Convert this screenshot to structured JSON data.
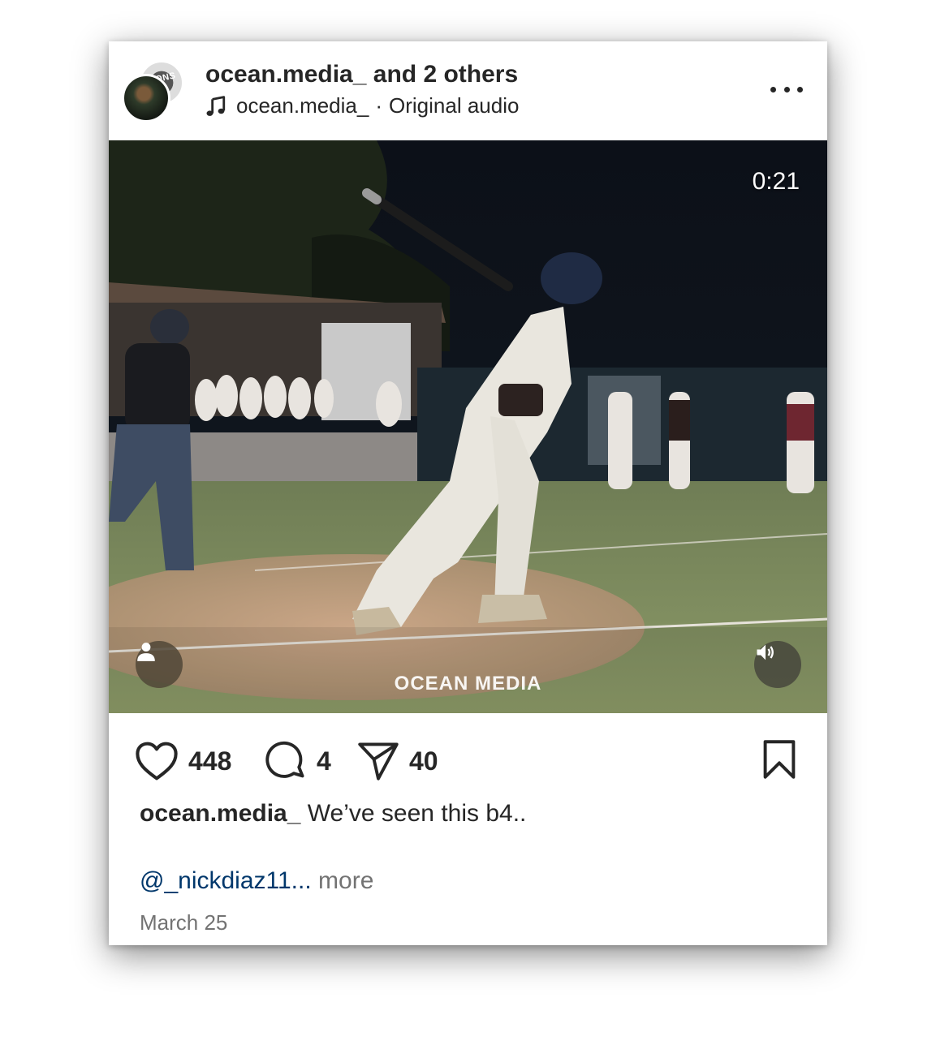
{
  "header": {
    "username": "ocean.media_",
    "collab_suffix": "and 2 others",
    "audio_owner": "ocean.media_",
    "audio_separator": "·",
    "audio_label": "Original audio",
    "avatar_back_text": "PIONS"
  },
  "media": {
    "duration": "0:21",
    "watermark": "OCEAN MEDIA"
  },
  "actions": {
    "likes": "448",
    "comments": "4",
    "shares": "40"
  },
  "caption": {
    "username": "ocean.media_",
    "text": "We’ve seen this b4..",
    "mention": "@_nickdiaz11",
    "ellipsis": "...",
    "more_label": "more"
  },
  "date": "March 25",
  "colors": {
    "text": "#262626",
    "secondary": "#737373",
    "mention": "#00376b"
  }
}
